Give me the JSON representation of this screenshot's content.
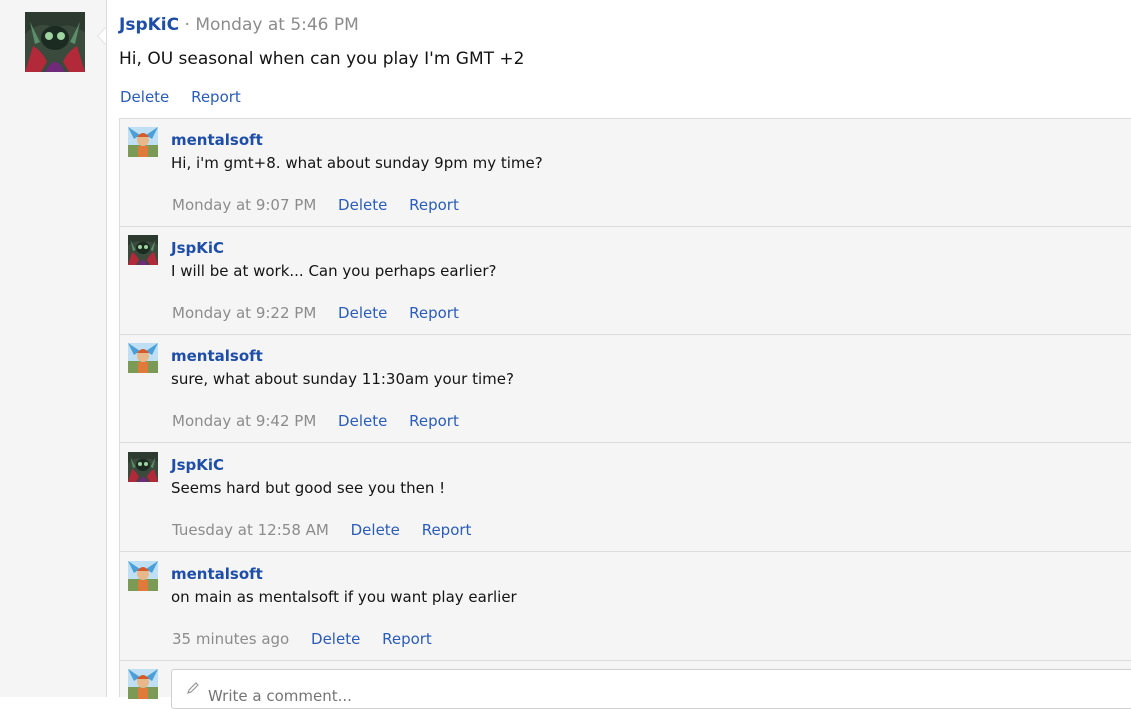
{
  "status": {
    "author": "JspKiC",
    "separator": "·",
    "time": "Monday at 5:46 PM",
    "text": "Hi, OU seasonal when can you play I'm GMT +2",
    "actions": {
      "delete": "Delete",
      "report": "Report"
    }
  },
  "comments": [
    {
      "author": "mentalsoft",
      "avatar": "mentalsoft-avatar",
      "text": "Hi, i'm gmt+8. what about sunday 9pm my time?",
      "time": "Monday at 9:07 PM",
      "delete": "Delete",
      "report": "Report"
    },
    {
      "author": "JspKiC",
      "avatar": "jspkic-avatar",
      "text": "I will be at work... Can you perhaps earlier?",
      "time": "Monday at 9:22 PM",
      "delete": "Delete",
      "report": "Report"
    },
    {
      "author": "mentalsoft",
      "avatar": "mentalsoft-avatar",
      "text": "sure, what about sunday 11:30am your time?",
      "time": "Monday at 9:42 PM",
      "delete": "Delete",
      "report": "Report"
    },
    {
      "author": "JspKiC",
      "avatar": "jspkic-avatar",
      "text": "Seems hard but good see you then !",
      "time": "Tuesday at 12:58 AM",
      "delete": "Delete",
      "report": "Report"
    },
    {
      "author": "mentalsoft",
      "avatar": "mentalsoft-avatar",
      "text": "on main as mentalsoft if you want play earlier",
      "time": "35 minutes ago",
      "delete": "Delete",
      "report": "Report"
    }
  ],
  "reply": {
    "placeholder": "Write a comment..."
  },
  "colors": {
    "link": "#1e4ea8",
    "muted": "#8c8c8c",
    "panel": "#f5f5f5",
    "border": "#dcdcdc"
  }
}
